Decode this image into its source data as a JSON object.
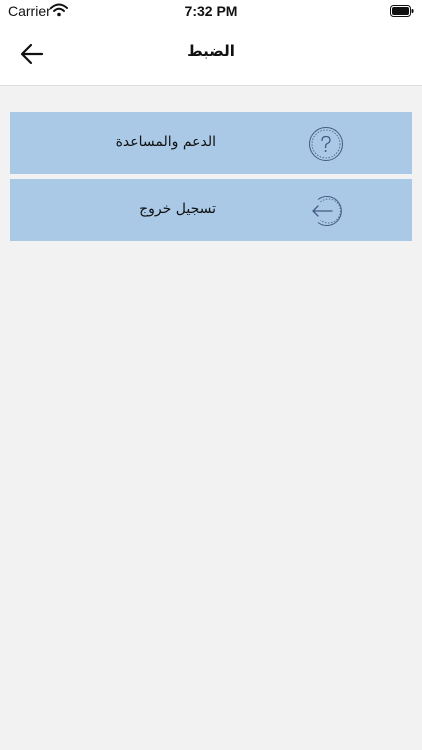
{
  "status_bar": {
    "carrier": "Carrier",
    "time": "7:32 PM"
  },
  "nav": {
    "title": "الضبط",
    "back_icon": "arrow-left-icon"
  },
  "menu": {
    "items": [
      {
        "label": "الدعم والمساعدة",
        "icon": "question-circle-icon"
      },
      {
        "label": "تسجيل خروج",
        "icon": "logout-arrow-icon"
      }
    ]
  },
  "colors": {
    "item_background": "#a9c9e7",
    "page_background": "#f2f2f2",
    "icon_stroke": "#445a80"
  }
}
